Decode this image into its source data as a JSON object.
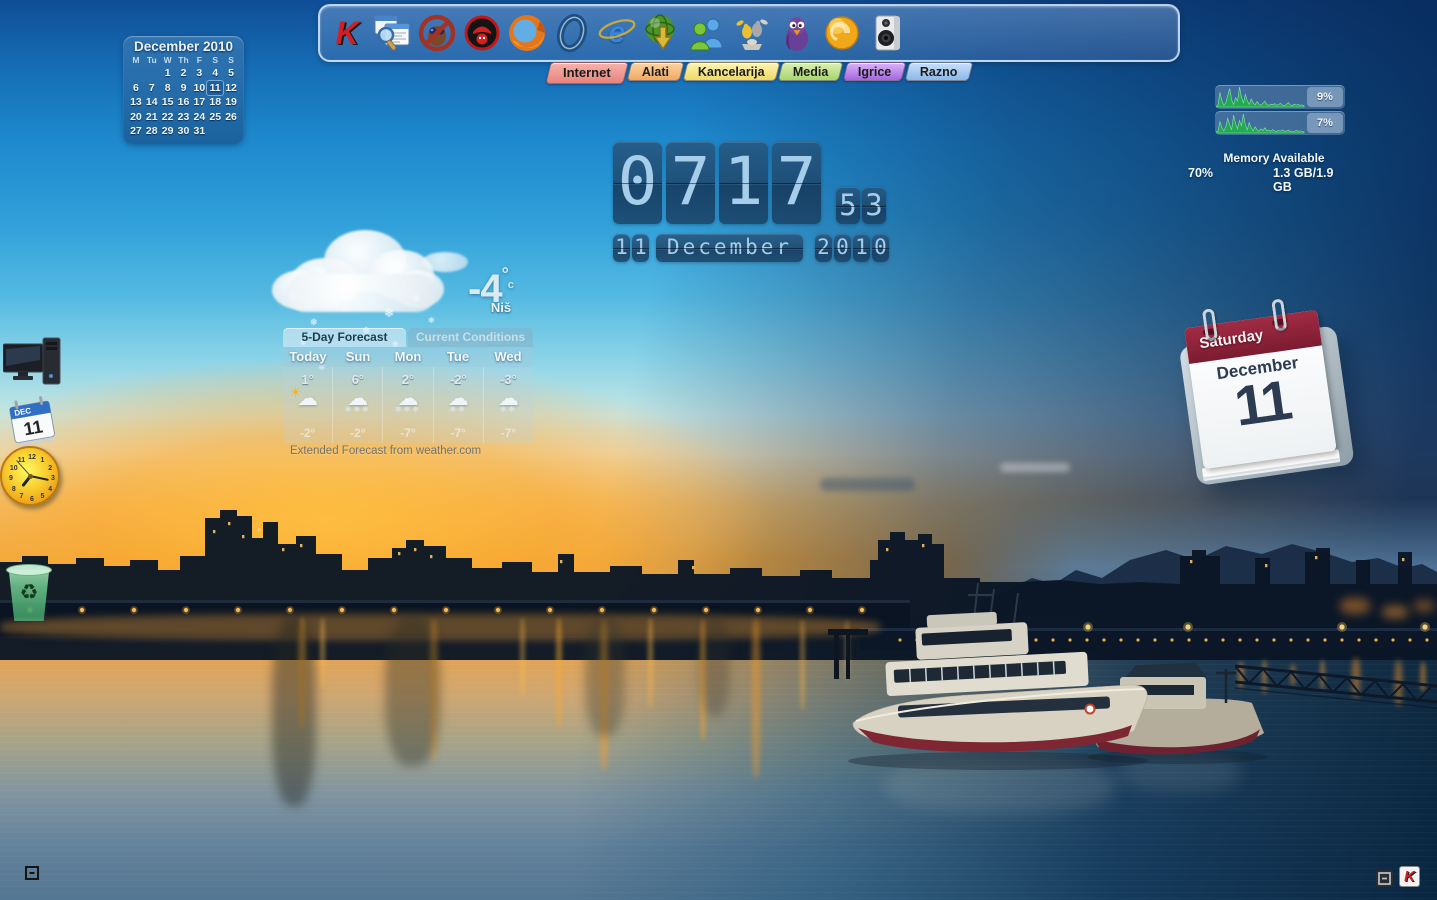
{
  "dock": {
    "tabs": [
      {
        "label": "Internet",
        "active": true,
        "c1": "#f6b3ab",
        "c2": "#e8837d"
      },
      {
        "label": "Alati",
        "active": false,
        "c1": "#fbd4a4",
        "c2": "#f2a95e"
      },
      {
        "label": "Kancelarija",
        "active": false,
        "c1": "#fbf4b4",
        "c2": "#eeda64"
      },
      {
        "label": "Media",
        "active": false,
        "c1": "#daefb4",
        "c2": "#a8d76a"
      },
      {
        "label": "Igrice",
        "active": false,
        "c1": "#dab3f5",
        "c2": "#a668e0"
      },
      {
        "label": "Razno",
        "active": false,
        "c1": "#c8dff8",
        "c2": "#8cb8ea"
      }
    ],
    "icons": [
      {
        "name": "kaspersky-icon",
        "glyph": "K"
      },
      {
        "name": "window-search-icon"
      },
      {
        "name": "no-spy-binoculars-icon"
      },
      {
        "name": "spy-agent-icon"
      },
      {
        "name": "firefox-icon"
      },
      {
        "name": "opera-icon"
      },
      {
        "name": "internet-explorer-icon",
        "glyph": "e"
      },
      {
        "name": "download-globe-icon"
      },
      {
        "name": "messenger-icon"
      },
      {
        "name": "im-birds-icon"
      },
      {
        "name": "pidgin-icon"
      },
      {
        "name": "dcpp-coin-icon"
      },
      {
        "name": "speaker-icon"
      }
    ]
  },
  "month_calendar": {
    "title": "December 2010",
    "day_headers": [
      "M",
      "Tu",
      "W",
      "Th",
      "F",
      "S",
      "S"
    ],
    "weeks": [
      [
        "",
        "",
        "1",
        "2",
        "3",
        "4",
        "5"
      ],
      [
        "6",
        "7",
        "8",
        "9",
        "10",
        "11",
        "12"
      ],
      [
        "13",
        "14",
        "15",
        "16",
        "17",
        "18",
        "19"
      ],
      [
        "20",
        "21",
        "22",
        "23",
        "24",
        "25",
        "26"
      ],
      [
        "27",
        "28",
        "29",
        "30",
        "31",
        "",
        ""
      ]
    ],
    "selected_day": "11"
  },
  "flip_clock": {
    "h1": "0",
    "h2": "7",
    "m1": "1",
    "m2": "7",
    "s1": "5",
    "s2": "3",
    "day1": "1",
    "day2": "1",
    "month": "December",
    "y1": "2",
    "y2": "0",
    "y3": "1",
    "y4": "0"
  },
  "weather": {
    "temp": "-4",
    "degree": "°",
    "unit": "c",
    "location": "Niš",
    "tab_forecast": "5-Day Forecast",
    "tab_current": "Current Conditions",
    "days": [
      {
        "name": "Today",
        "high": "1°",
        "low": "-2°",
        "icon": "sun-cloud"
      },
      {
        "name": "Sun",
        "high": "6°",
        "low": "-2°",
        "icon": "snow-rain"
      },
      {
        "name": "Mon",
        "high": "2°",
        "low": "-7°",
        "icon": "snow-rain"
      },
      {
        "name": "Tue",
        "high": "-2°",
        "low": "-7°",
        "icon": "snow"
      },
      {
        "name": "Wed",
        "high": "-3°",
        "low": "-7°",
        "icon": "snow"
      }
    ],
    "footer": "Extended Forecast from weather.com",
    "flake_glyph": "❄",
    "cloud_glyph": "☁",
    "sun_glyph": "☀"
  },
  "system_monitor": {
    "graph1_label": "9%",
    "graph2_label": "7%",
    "memory_label": "Memory Available",
    "memory_percent": "70%",
    "memory_value": "1.3 GB/1.9 GB",
    "graph_color": "#22b14c",
    "history1": [
      4,
      6,
      70,
      30,
      8,
      20,
      55,
      88,
      35,
      12,
      45,
      28,
      95,
      50,
      18,
      60,
      30,
      12,
      38,
      20,
      10,
      26,
      14,
      8,
      18,
      28,
      12,
      8,
      14,
      10,
      16,
      8,
      12,
      18,
      9,
      6,
      12,
      22,
      10,
      7,
      14,
      9,
      12,
      8,
      10,
      6
    ],
    "history2": [
      5,
      8,
      55,
      25,
      10,
      30,
      70,
      40,
      15,
      85,
      45,
      20,
      60,
      35,
      90,
      40,
      15,
      50,
      25,
      10,
      30,
      15,
      8,
      20,
      12,
      25,
      10,
      14,
      8,
      16,
      10,
      7,
      12,
      9,
      15,
      8,
      10,
      14,
      7,
      10,
      6,
      12,
      8,
      10,
      7,
      5
    ]
  },
  "desk_calendar": {
    "weekday": "Saturday",
    "month": "December",
    "day": "11"
  },
  "desktop_icons": {
    "mini_calendar_month": "DEC",
    "mini_calendar_day": "11",
    "clock_numbers": [
      "12",
      "1",
      "2",
      "3",
      "4",
      "5",
      "6",
      "7",
      "8",
      "9",
      "10",
      "11"
    ],
    "recycle_glyph": "♻"
  },
  "tray": {
    "kaspersky_glyph": "K"
  }
}
